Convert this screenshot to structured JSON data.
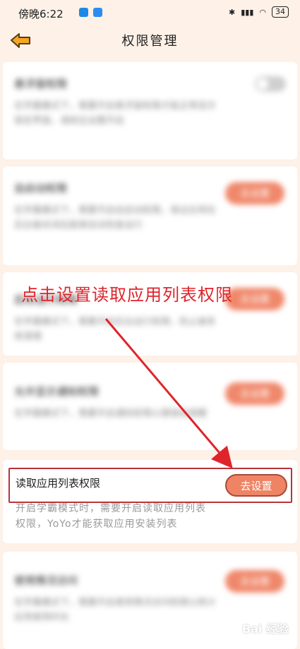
{
  "status_bar": {
    "time": "傍晚6:22",
    "battery": "34"
  },
  "header": {
    "title": "权限管理",
    "back_icon": "back-arrow-icon"
  },
  "cards": [
    {
      "title": "悬浮窗权限",
      "desc": "在学霸模式下，需要开启悬浮窗权限才能正常显示锁定界面，请前往设置开启"
    },
    {
      "title": "自启动权限",
      "button": "去设置",
      "desc": "在学霸模式下，需要开启自启动权限，保证应用在后台被关闭后能够自动恢复运行"
    },
    {
      "title": "后台运行权限",
      "button": "去设置",
      "desc": "在学霸模式下，需要开启后台运行权限，防止被系统清理"
    },
    {
      "title": "允许显示通知权限",
      "button": "去设置",
      "desc": "在学霸模式下，需要开启通知权限以便接收提醒"
    },
    {
      "title": "读取应用列表权限",
      "button": "去设置",
      "desc": "开启学霸模式时，需要开启读取应用列表权限，YoYo才能获取应用安装列表"
    },
    {
      "title": "使用情况访问",
      "button": "去设置",
      "desc": "在学霸模式下，需要开启使用情况访问权限以统计应用使用时长"
    }
  ],
  "annotation": {
    "text": "点击设置读取应用列表权限",
    "color": "#e0242b"
  },
  "watermark": "Bai 经验",
  "colors": {
    "accent": "#ef8465",
    "background": "#fdf1e8",
    "annotation_red": "#e0242b"
  }
}
